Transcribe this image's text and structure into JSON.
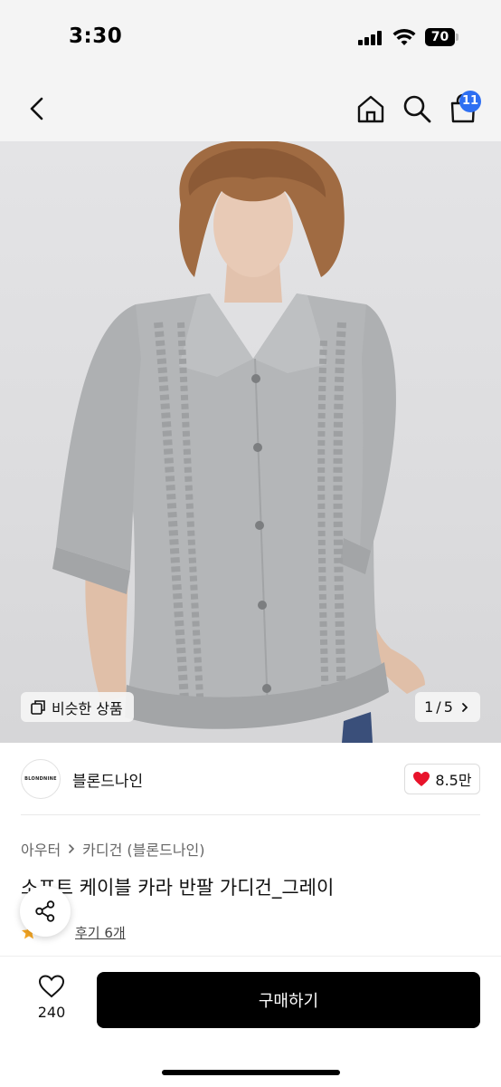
{
  "status_bar": {
    "time": "3:30",
    "battery": "70"
  },
  "nav": {
    "cart_badge": "11"
  },
  "image": {
    "similar_label": "비슷한 상품",
    "page_current": "1",
    "page_sep": "/",
    "page_total": "5"
  },
  "seller": {
    "logo_text": "BLONDNINE",
    "name": "블론드나인"
  },
  "likes": {
    "count": "8.5만"
  },
  "category": {
    "level1": "아우터",
    "level2": "카디건 (블론드나인)"
  },
  "product": {
    "title": "소프트 케이블 카라 반팔 가디건_그레이",
    "review_label": "후기 6개"
  },
  "bottom": {
    "wish_count": "240",
    "buy_label": "구매하기"
  },
  "icons": [
    "back-icon",
    "home-icon",
    "search-icon",
    "cart-icon",
    "similar-icon",
    "chevron-right-icon",
    "heart-icon",
    "share-icon",
    "star-icon",
    "wish-heart-icon"
  ],
  "colors": {
    "accent_badge": "#2e6ff2",
    "heart": "#e8132b",
    "buy_button": "#000000",
    "star": "#f5a623"
  }
}
